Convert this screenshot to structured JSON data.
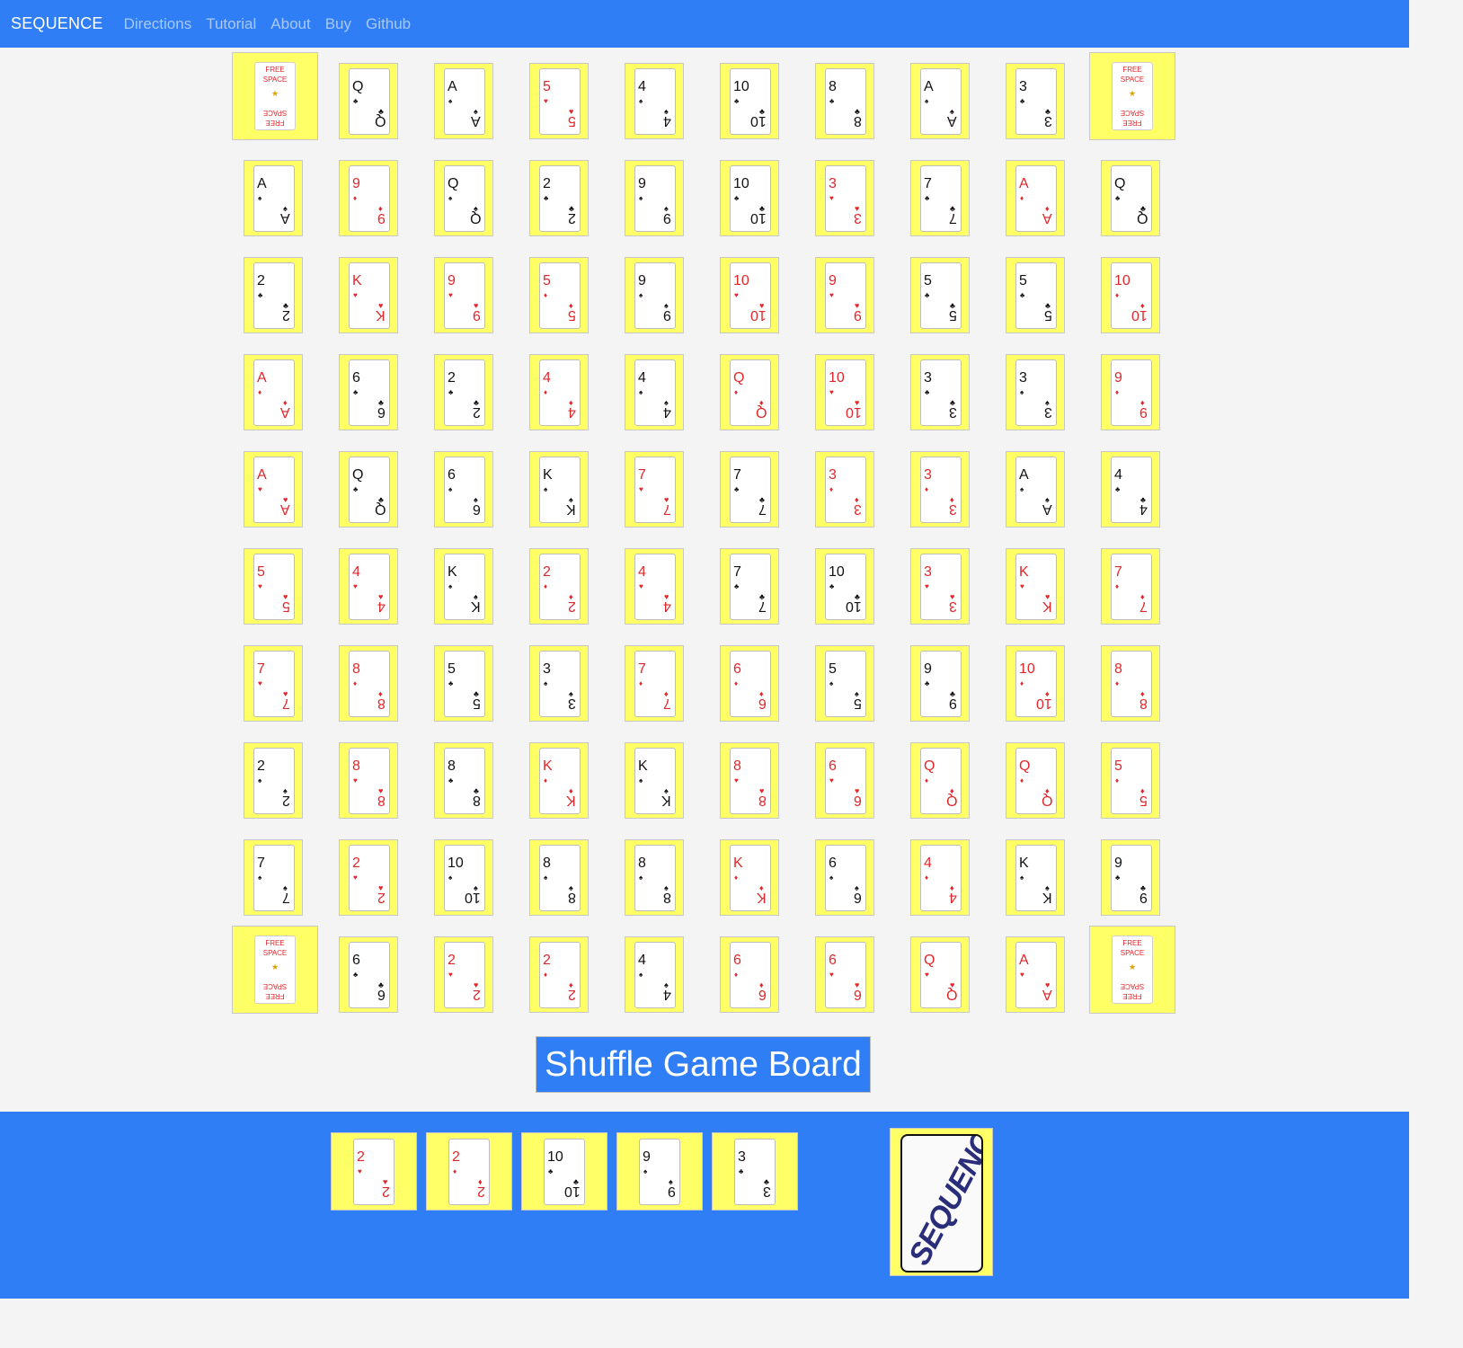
{
  "nav": {
    "brand": "SEQUENCE",
    "links": [
      "Directions",
      "Tutorial",
      "About",
      "Buy",
      "Github"
    ]
  },
  "colors": {
    "nav_bg": "#2f7ef5",
    "cell_bg": "#ffff66",
    "red_suit": "#e3262a",
    "black_suit": "#111111",
    "page_bg": "#f4f4f4"
  },
  "free_space": {
    "top": "FREE",
    "middle": "SPACE"
  },
  "board": [
    [
      "FREE",
      "Q♣",
      "A♠",
      "5♥",
      "4♠",
      "10♣",
      "8♣",
      "A♠",
      "3♣",
      "FREE"
    ],
    [
      "A♠",
      "9♦",
      "Q♠",
      "2♣",
      "9♠",
      "10♣",
      "3♥",
      "7♣",
      "A♦",
      "Q♣"
    ],
    [
      "2♣",
      "K♥",
      "9♥",
      "5♦",
      "9♠",
      "10♥",
      "9♥",
      "5♣",
      "5♣",
      "10♦"
    ],
    [
      "A♦",
      "6♣",
      "2♣",
      "4♦",
      "4♠",
      "Q♦",
      "10♥",
      "3♣",
      "3♠",
      "9♦"
    ],
    [
      "A♥",
      "Q♣",
      "6♠",
      "K♠",
      "7♥",
      "7♣",
      "3♦",
      "3♦",
      "A♠",
      "4♣"
    ],
    [
      "5♥",
      "4♥",
      "K♠",
      "2♦",
      "4♥",
      "7♣",
      "10♣",
      "3♥",
      "K♥",
      "7♦"
    ],
    [
      "7♥",
      "8♦",
      "5♣",
      "3♠",
      "7♦",
      "6♦",
      "5♠",
      "9♣",
      "10♦",
      "8♦"
    ],
    [
      "2♠",
      "8♥",
      "8♣",
      "K♦",
      "K♠",
      "8♥",
      "6♥",
      "Q♦",
      "Q♦",
      "5♦"
    ],
    [
      "7♠",
      "2♥",
      "10♠",
      "8♠",
      "8♠",
      "K♦",
      "6♠",
      "4♦",
      "K♠",
      "9♣"
    ],
    [
      "FREE",
      "6♣",
      "2♥",
      "2♦",
      "4♠",
      "6♦",
      "6♥",
      "Q♥",
      "A♥",
      "FREE"
    ]
  ],
  "shuffle_label": "Shuffle Game Board",
  "hand": [
    "2♥",
    "2♦",
    "10♣",
    "9♠",
    "3♣"
  ],
  "deck": {
    "logo_text": "SEQUENCE"
  }
}
